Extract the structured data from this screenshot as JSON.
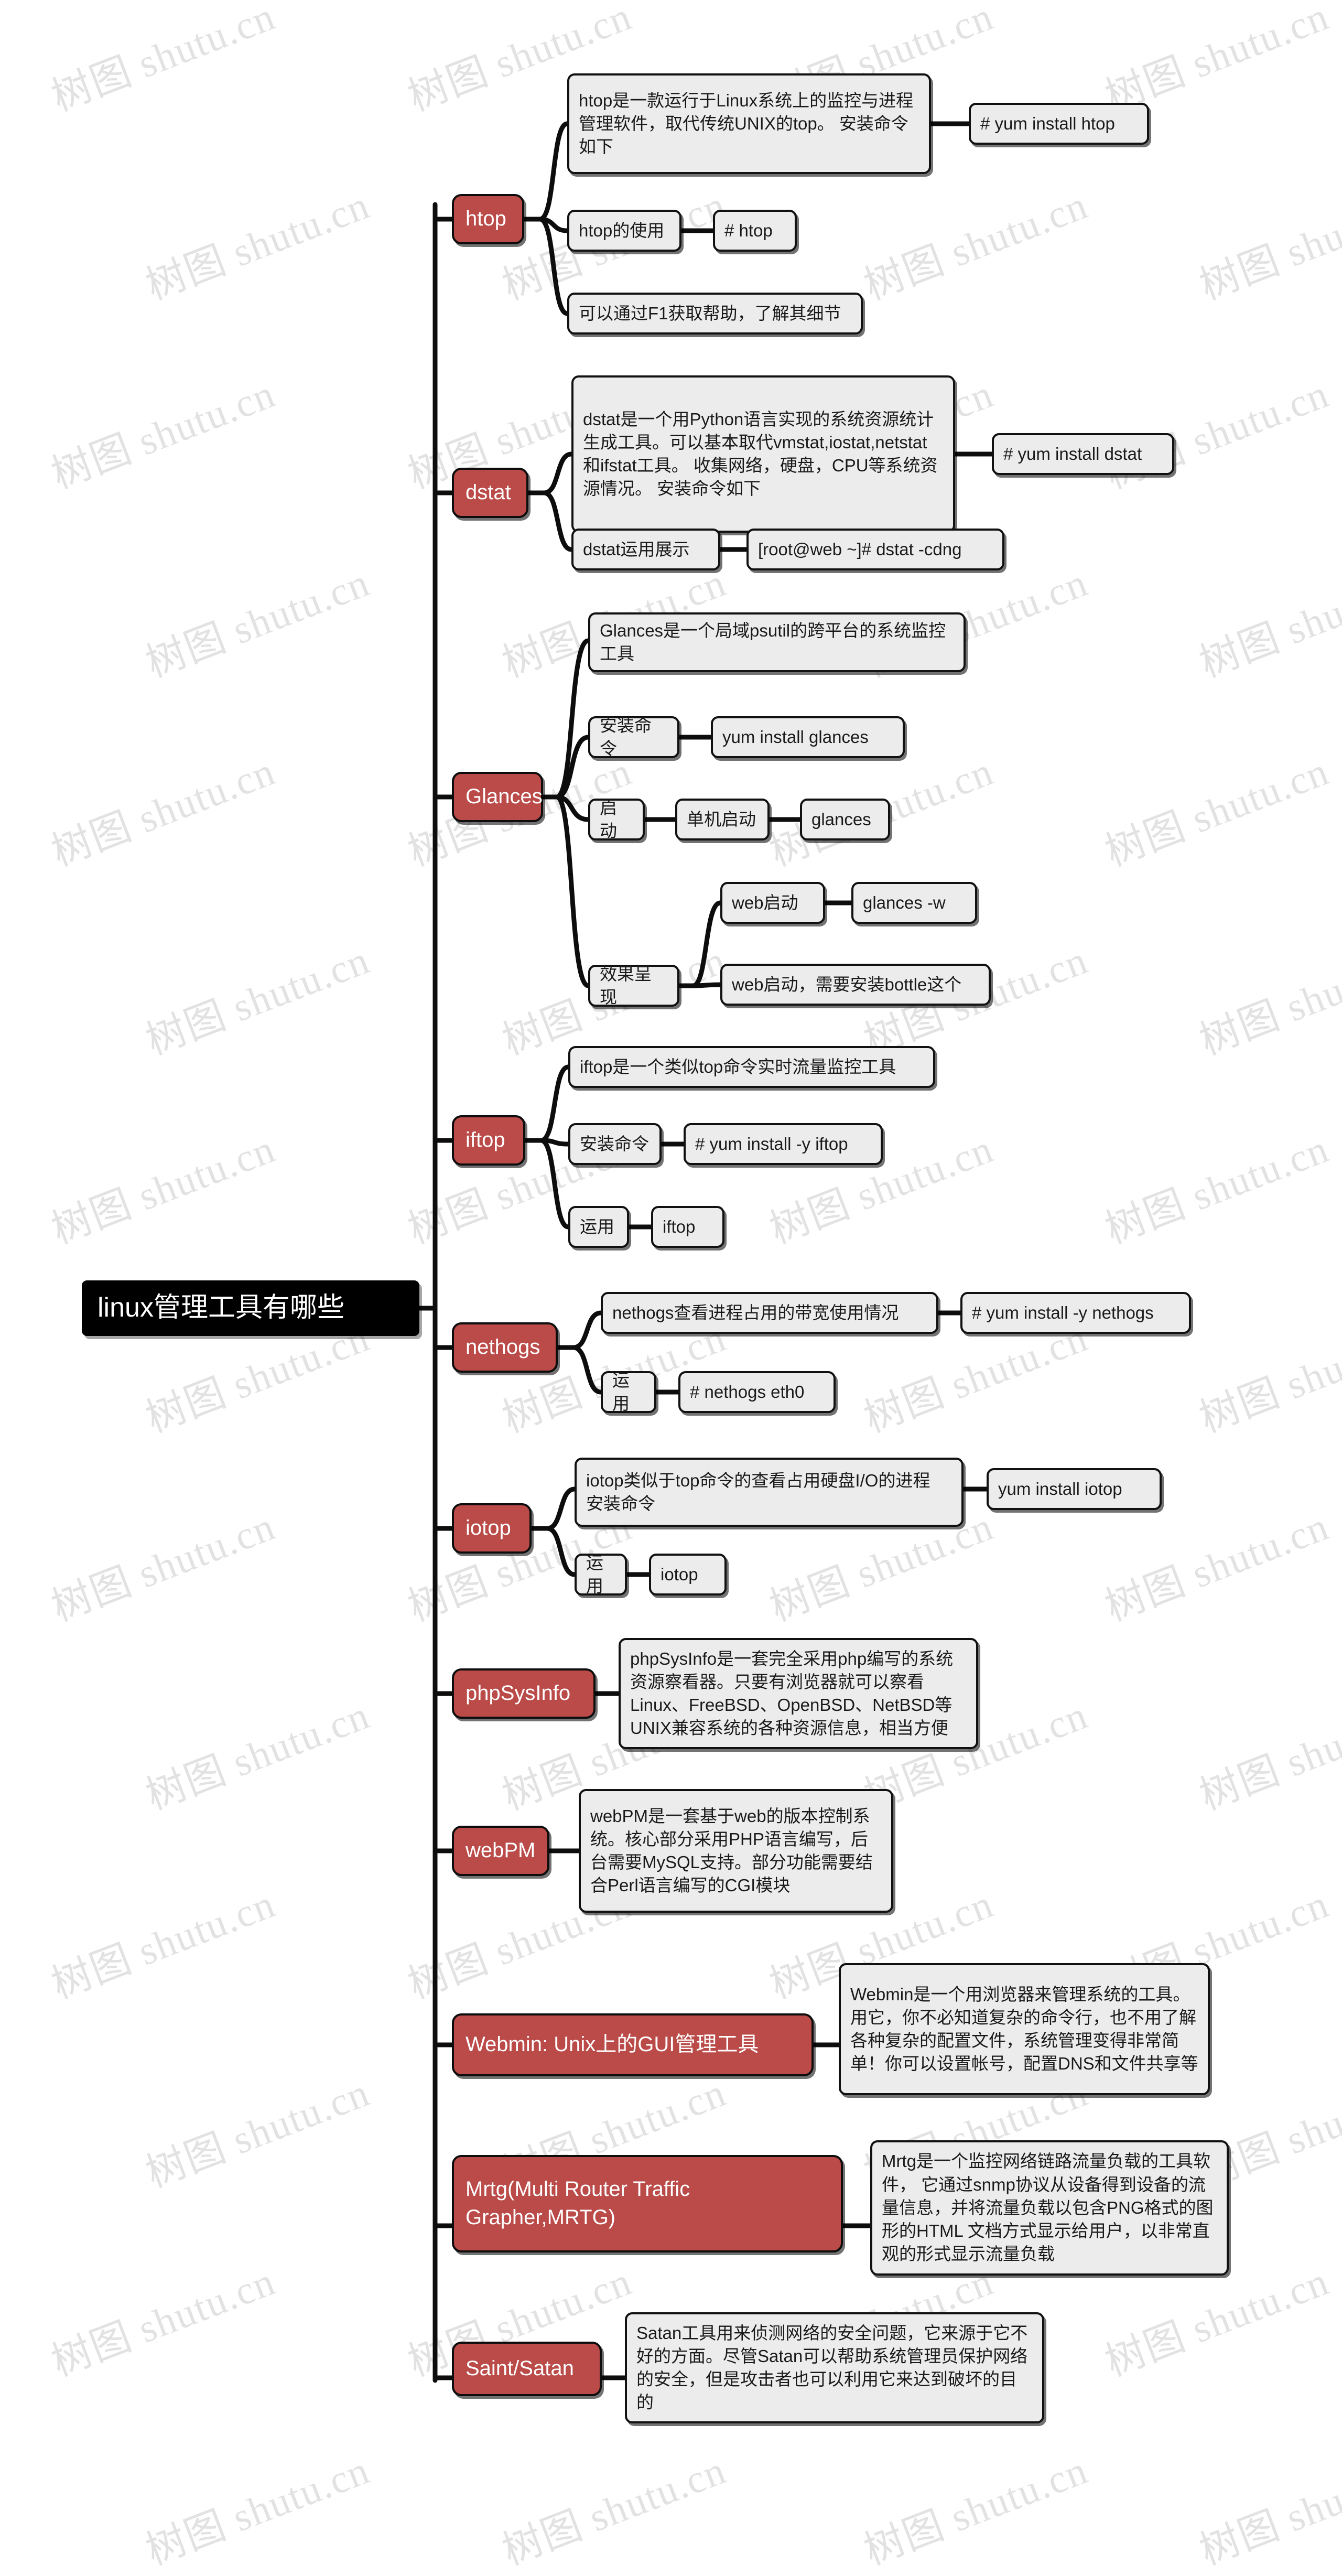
{
  "diagram": {
    "type": "mindmap",
    "watermark_text": "树图 shutu.cn",
    "colors": {
      "root_bg": "#000000",
      "root_text": "#ffffff",
      "topic_bg": "#ba4b49",
      "topic_text": "#ffffff",
      "box_bg": "#ececec",
      "box_border": "#111111",
      "box_text": "#1a1a1a",
      "connector": "#0d0d0d",
      "watermark": "#e2e2e2",
      "canvas_bg": "#ffffff"
    },
    "root": {
      "label": "linux管理工具有哪些"
    },
    "branches": [
      {
        "id": "htop",
        "label": "htop",
        "children": [
          {
            "label": "htop是一款运行于Linux系统上的监控与进程管理软件，取代传统UNIX的top。 安装命令如下",
            "children": [
              {
                "label": "# yum install htop"
              }
            ]
          },
          {
            "label": "htop的使用",
            "children": [
              {
                "label": "# htop"
              }
            ]
          },
          {
            "label": "可以通过F1获取帮助，了解其细节",
            "children": []
          }
        ]
      },
      {
        "id": "dstat",
        "label": "dstat",
        "children": [
          {
            "label": "dstat是一个用Python语言实现的系统资源统计生成工具。可以基本取代vmstat,iostat,netstat和ifstat工具。 收集网络，硬盘，CPU等系统资源情况。 安装命令如下",
            "children": [
              {
                "label": "# yum install dstat"
              }
            ]
          },
          {
            "label": "dstat运用展示",
            "children": [
              {
                "label": "[root@web ~]# dstat -cdng"
              }
            ]
          }
        ]
      },
      {
        "id": "glances",
        "label": "Glances",
        "children": [
          {
            "label": "Glances是一个局域psutil的跨平台的系统监控工具",
            "children": []
          },
          {
            "label": "安装命令",
            "children": [
              {
                "label": "yum install glances"
              }
            ]
          },
          {
            "label": "启动",
            "children": [
              {
                "label": "单机启动",
                "children": [
                  {
                    "label": "glances"
                  }
                ]
              }
            ]
          },
          {
            "label": "效果呈现",
            "children": [
              {
                "label": "web启动",
                "children": [
                  {
                    "label": "glances -w"
                  }
                ]
              },
              {
                "label": "web启动，需要安装bottle这个",
                "children": []
              }
            ]
          }
        ]
      },
      {
        "id": "iftop",
        "label": "iftop",
        "children": [
          {
            "label": "iftop是一个类似top命令实时流量监控工具",
            "children": []
          },
          {
            "label": "安装命令",
            "children": [
              {
                "label": "# yum install -y iftop"
              }
            ]
          },
          {
            "label": "运用",
            "children": [
              {
                "label": "iftop"
              }
            ]
          }
        ]
      },
      {
        "id": "nethogs",
        "label": "nethogs",
        "children": [
          {
            "label": "nethogs查看进程占用的带宽使用情况",
            "children": [
              {
                "label": "# yum install -y nethogs"
              }
            ]
          },
          {
            "label": "运用",
            "children": [
              {
                "label": "# nethogs eth0"
              }
            ]
          }
        ]
      },
      {
        "id": "iotop",
        "label": "iotop",
        "children": [
          {
            "label": "iotop类似于top命令的查看占用硬盘I/O的进程 安装命令",
            "children": [
              {
                "label": "yum install iotop"
              }
            ]
          },
          {
            "label": "运用",
            "children": [
              {
                "label": "iotop"
              }
            ]
          }
        ]
      },
      {
        "id": "phpsysinfo",
        "label": "phpSysInfo",
        "children": [
          {
            "label": "phpSysInfo是一套完全采用php编写的系统资源察看器。只要有浏览器就可以察看Linux、FreeBSD、OpenBSD、NetBSD等UNIX兼容系统的各种资源信息，相当方便",
            "children": []
          }
        ]
      },
      {
        "id": "webpm",
        "label": "webPM",
        "children": [
          {
            "label": "webPM是一套基于web的版本控制系统。核心部分采用PHP语言编写，后台需要MySQL支持。部分功能需要结合Perl语言编写的CGI模块",
            "children": []
          }
        ]
      },
      {
        "id": "webmin",
        "label": "Webmin: Unix上的GUI管理工具",
        "children": [
          {
            "label": "Webmin是一个用浏览器来管理系统的工具。用它，你不必知道复杂的命令行，也不用了解各种复杂的配置文件，系统管理变得非常简单！你可以设置帐号，配置DNS和文件共享等",
            "children": []
          }
        ]
      },
      {
        "id": "mrtg",
        "label": "Mrtg(Multi Router Traffic Grapher,MRTG)",
        "children": [
          {
            "label": "Mrtg是一个监控网络链路流量负载的工具软件， 它通过snmp协议从设备得到设备的流量信息，并将流量负载以包含PNG格式的图形的HTML 文档方式显示给用户，以非常直观的形式显示流量负载",
            "children": []
          }
        ]
      },
      {
        "id": "saint",
        "label": "Saint/Satan",
        "children": [
          {
            "label": "Satan工具用来侦测网络的安全问题，它来源于它不好的方面。尽管Satan可以帮助系统管理员保护网络的安全，但是攻击者也可以利用它来达到破坏的目的",
            "children": []
          }
        ]
      }
    ]
  }
}
